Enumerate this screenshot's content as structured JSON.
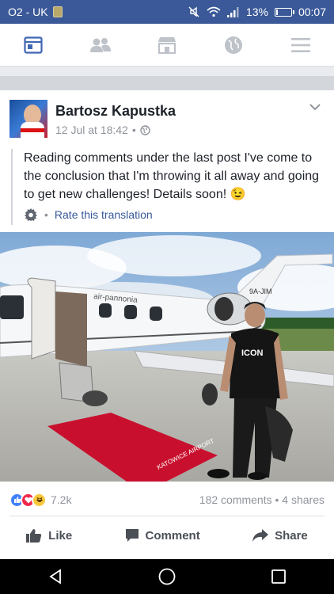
{
  "status_bar": {
    "carrier": "O2 - UK",
    "battery": "13%",
    "battery_level": 0.13,
    "time": "00:07"
  },
  "nav": {
    "tabs": [
      {
        "name": "news-feed",
        "icon": "news-feed-icon",
        "active": true
      },
      {
        "name": "friends",
        "icon": "friends-icon",
        "active": false
      },
      {
        "name": "marketplace",
        "icon": "marketplace-icon",
        "active": false
      },
      {
        "name": "notifications",
        "icon": "globe-icon",
        "active": false
      },
      {
        "name": "menu",
        "icon": "menu-icon",
        "active": false
      }
    ]
  },
  "post": {
    "author": "Bartosz Kapustka",
    "date": "12 Jul at 18:42",
    "separator": "•",
    "text": "Reading comments under the last post I've come to the conclusion that I'm throwing it all away and going to get new challenges! Details soon! 😉",
    "translate_dot": "•",
    "translate_label": "Rate this translation",
    "photo_texts": {
      "plane_brand": "air-pannonia",
      "registration": "9A-JIM",
      "shirt": "ICON",
      "carpet": "KATOWICE AIRPORT"
    }
  },
  "engagement": {
    "reactions_count": "7.2k",
    "comments": "182 comments",
    "dot": "•",
    "shares": "4 shares"
  },
  "actions": {
    "like": "Like",
    "comment": "Comment",
    "share": "Share"
  },
  "colors": {
    "brand": "#3b5998",
    "link": "#365899",
    "meta": "#90949c"
  }
}
